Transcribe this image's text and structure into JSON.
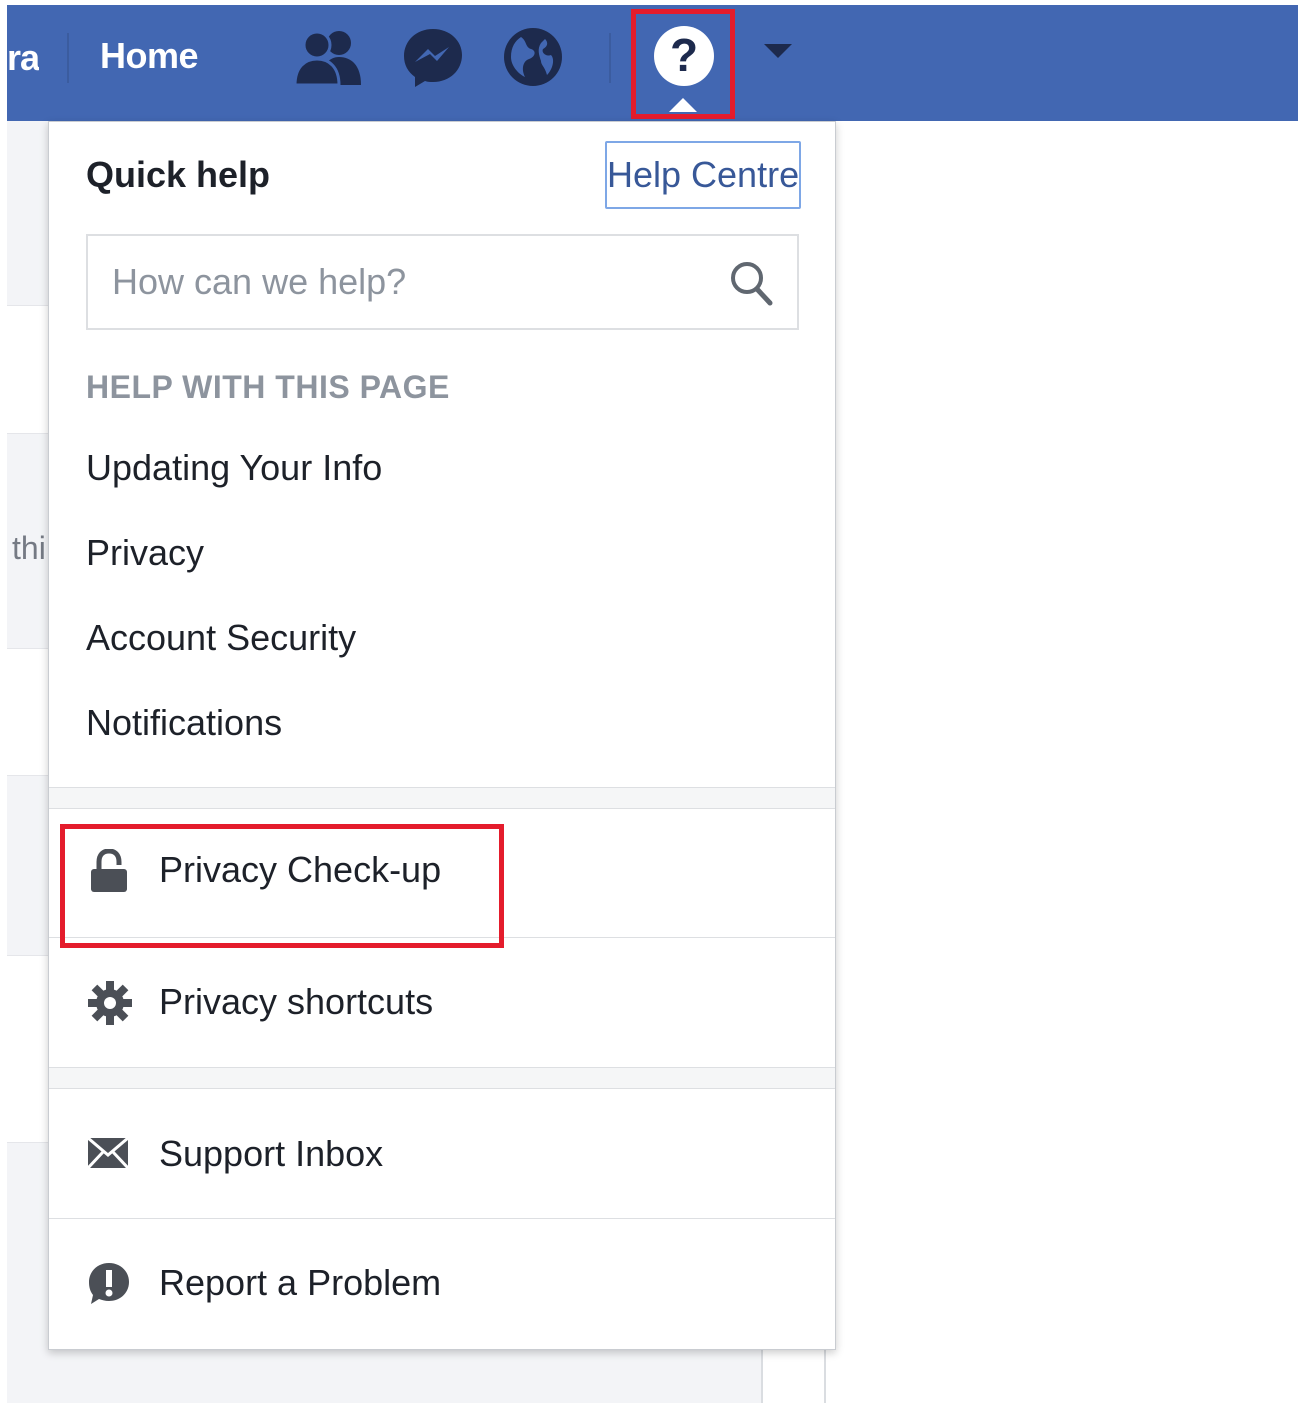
{
  "topbar": {
    "name_fragment": "ra",
    "home_label": "Home",
    "icons": [
      "friends-icon",
      "messenger-icon",
      "globe-icon",
      "help-icon",
      "account-menu-caret-icon"
    ],
    "background_color": "#4267b2",
    "help_glyph": "?"
  },
  "background_page": {
    "text_fragment": "thi"
  },
  "quick_help": {
    "title": "Quick help",
    "help_centre_label": "Help Centre",
    "search_placeholder": "How can we help?",
    "section_heading": "HELP WITH THIS PAGE",
    "help_links": [
      "Updating Your Info",
      "Privacy",
      "Account Security",
      "Notifications"
    ],
    "privacy_items": [
      {
        "label": "Privacy Check-up",
        "icon": "lock-icon"
      },
      {
        "label": "Privacy shortcuts",
        "icon": "gear-icon"
      }
    ],
    "support_items": [
      {
        "label": "Support Inbox",
        "icon": "envelope-icon"
      },
      {
        "label": "Report a Problem",
        "icon": "alert-icon"
      }
    ]
  },
  "highlight_color": "#e41c2c"
}
